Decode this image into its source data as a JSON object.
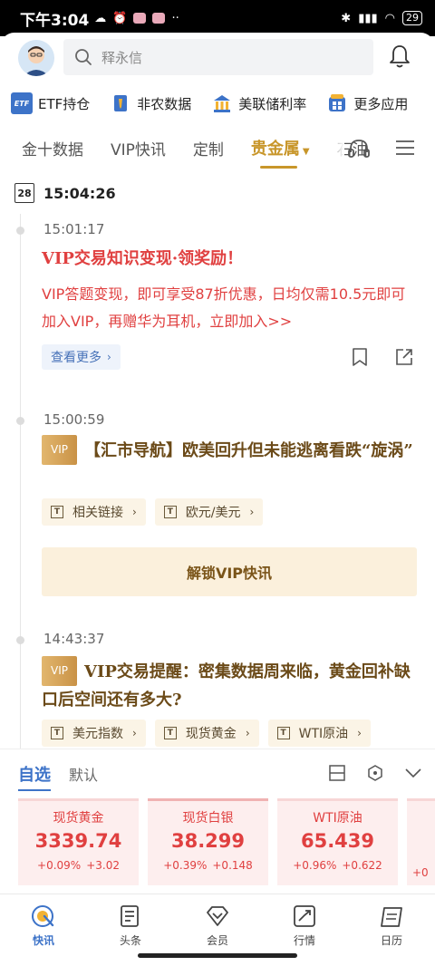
{
  "status": {
    "time": "下午3:04",
    "battery": "29"
  },
  "search": {
    "placeholder": "释永信"
  },
  "shortcuts": [
    {
      "label": "ETF持仓",
      "icon": "etf-icon"
    },
    {
      "label": "非农数据",
      "icon": "person-tie-icon"
    },
    {
      "label": "美联储利率",
      "icon": "bank-icon"
    },
    {
      "label": "更多应用",
      "icon": "grid-icon"
    }
  ],
  "tabs": [
    {
      "label": "金十数据"
    },
    {
      "label": "VIP快讯"
    },
    {
      "label": "定制"
    },
    {
      "label": "贵金属"
    },
    {
      "label": "石油"
    }
  ],
  "feed": {
    "calendar_day": "28",
    "date_time": "15:04:26",
    "items": [
      {
        "time": "15:01:17",
        "title": "VIP交易知识变现·领奖励！",
        "body": "VIP答题变现，即可享受87折优惠，日均仅需10.5元即可加入VIP，再赠华为耳机，立即加入>>",
        "more_label": "查看更多"
      },
      {
        "time": "15:00:59",
        "badge": "VIP",
        "title": "【汇市导航】欧美回升但未能逃离看跌“旋涡”",
        "tags": [
          "相关链接",
          "欧元/美元"
        ],
        "unlock_label": "解锁VIP快讯"
      },
      {
        "time": "14:43:37",
        "badge": "VIP",
        "title": "VIP交易提醒：密集数据周来临，黄金回补缺口后空间还有多大?",
        "tags": [
          "美元指数",
          "现货黄金",
          "WTI原油"
        ]
      }
    ]
  },
  "watchlist": {
    "tabs": [
      "自选",
      "默认"
    ],
    "quotes": [
      {
        "name": "现货黄金",
        "price": "3339.74",
        "pct": "+0.09%",
        "chg": "+3.02"
      },
      {
        "name": "现货白银",
        "price": "38.299",
        "pct": "+0.39%",
        "chg": "+0.148"
      },
      {
        "name": "WTI原油",
        "price": "65.439",
        "pct": "+0.96%",
        "chg": "+0.622"
      },
      {
        "partial": "+0"
      }
    ],
    "colors": {
      "up": "#e04040",
      "accent": "#3d73c8"
    }
  },
  "nav": [
    {
      "label": "快讯"
    },
    {
      "label": "头条"
    },
    {
      "label": "会员"
    },
    {
      "label": "行情"
    },
    {
      "label": "日历"
    }
  ]
}
